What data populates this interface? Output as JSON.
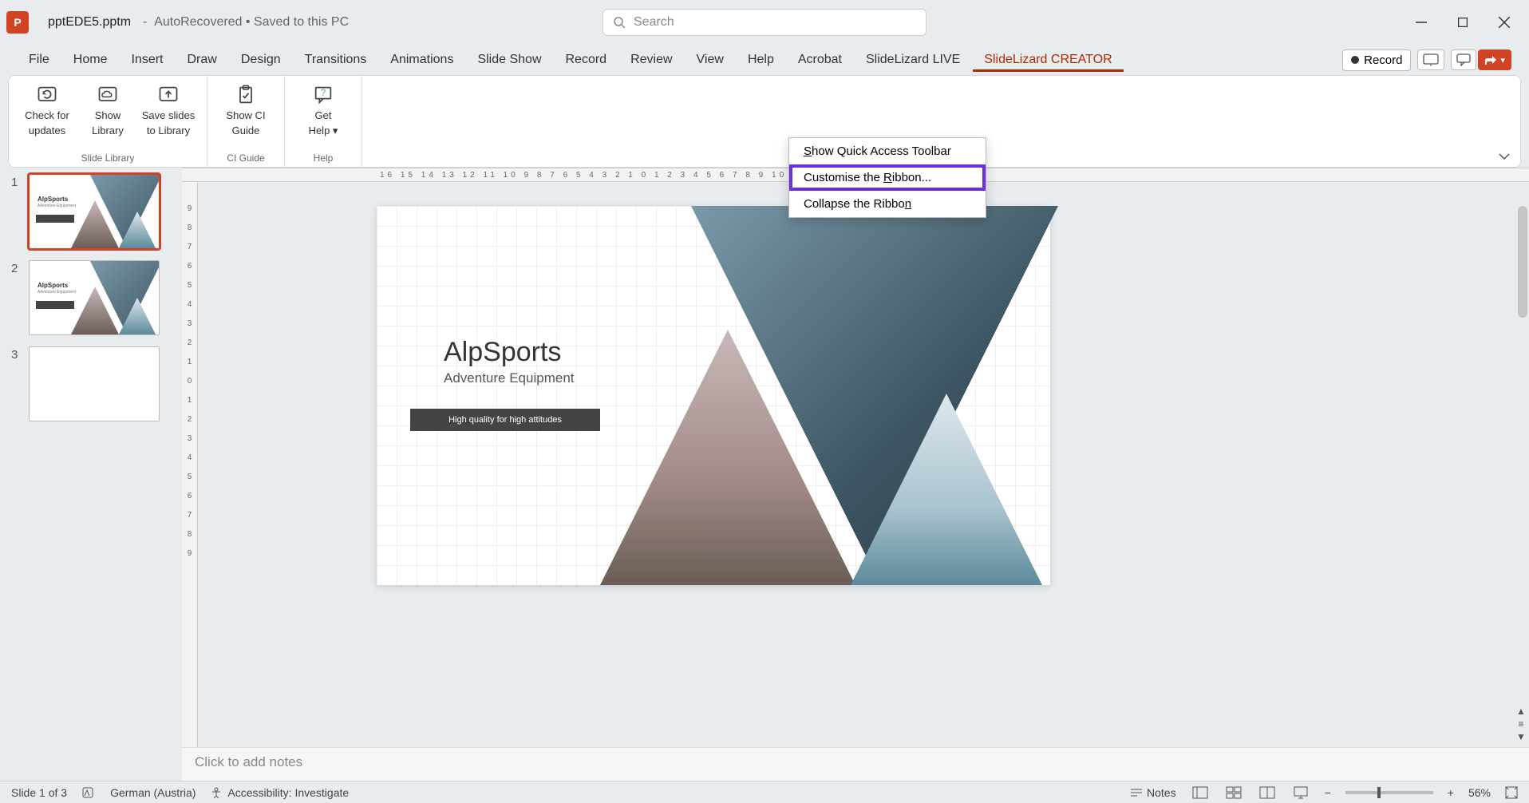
{
  "titlebar": {
    "filename": "pptEDE5.pptm",
    "status": "AutoRecovered • Saved to this PC",
    "search_placeholder": "Search"
  },
  "ribbon_tabs": {
    "items": [
      "File",
      "Home",
      "Insert",
      "Draw",
      "Design",
      "Transitions",
      "Animations",
      "Slide Show",
      "Record",
      "Review",
      "View",
      "Help",
      "Acrobat",
      "SlideLizard LIVE",
      "SlideLizard CREATOR"
    ],
    "active_index": 14,
    "record_label": "Record"
  },
  "ribbon": {
    "groups": [
      {
        "label": "Slide Library",
        "buttons": [
          {
            "line1": "Check for",
            "line2": "updates",
            "icon": "refresh"
          },
          {
            "line1": "Show",
            "line2": "Library",
            "icon": "cloud"
          },
          {
            "line1": "Save slides",
            "line2": "to Library",
            "icon": "upload"
          }
        ]
      },
      {
        "label": "CI Guide",
        "buttons": [
          {
            "line1": "Show CI",
            "line2": "Guide",
            "icon": "clipboard"
          }
        ]
      },
      {
        "label": "Help",
        "buttons": [
          {
            "line1": "Get",
            "line2": "Help ▾",
            "icon": "help"
          }
        ]
      }
    ]
  },
  "context_menu": {
    "items": [
      {
        "before": "",
        "u": "S",
        "after": "how Quick Access Toolbar"
      },
      {
        "before": "Customise the ",
        "u": "R",
        "after": "ibbon..."
      },
      {
        "before": "Collapse the Ribbo",
        "u": "n",
        "after": ""
      }
    ],
    "highlighted_index": 1
  },
  "slide": {
    "title": "AlpSports",
    "subtitle": "Adventure Equipment",
    "tagline": "High quality for high attitudes"
  },
  "thumbnails": {
    "count": 3,
    "selected": 1
  },
  "ruler": {
    "h": "16  15  14  13  12  11  10  9  8  7  6  5  4  3  2  1  0  1  2  3  4  5  6  7  8  9  10  11  12  13  14  15  16",
    "v": [
      "9",
      "8",
      "7",
      "6",
      "5",
      "4",
      "3",
      "2",
      "1",
      "0",
      "1",
      "2",
      "3",
      "4",
      "5",
      "6",
      "7",
      "8",
      "9"
    ]
  },
  "notes": {
    "placeholder": "Click to add notes"
  },
  "status": {
    "slide_info": "Slide 1 of 3",
    "language": "German (Austria)",
    "accessibility": "Accessibility: Investigate",
    "notes_btn": "Notes",
    "zoom": "56%"
  }
}
